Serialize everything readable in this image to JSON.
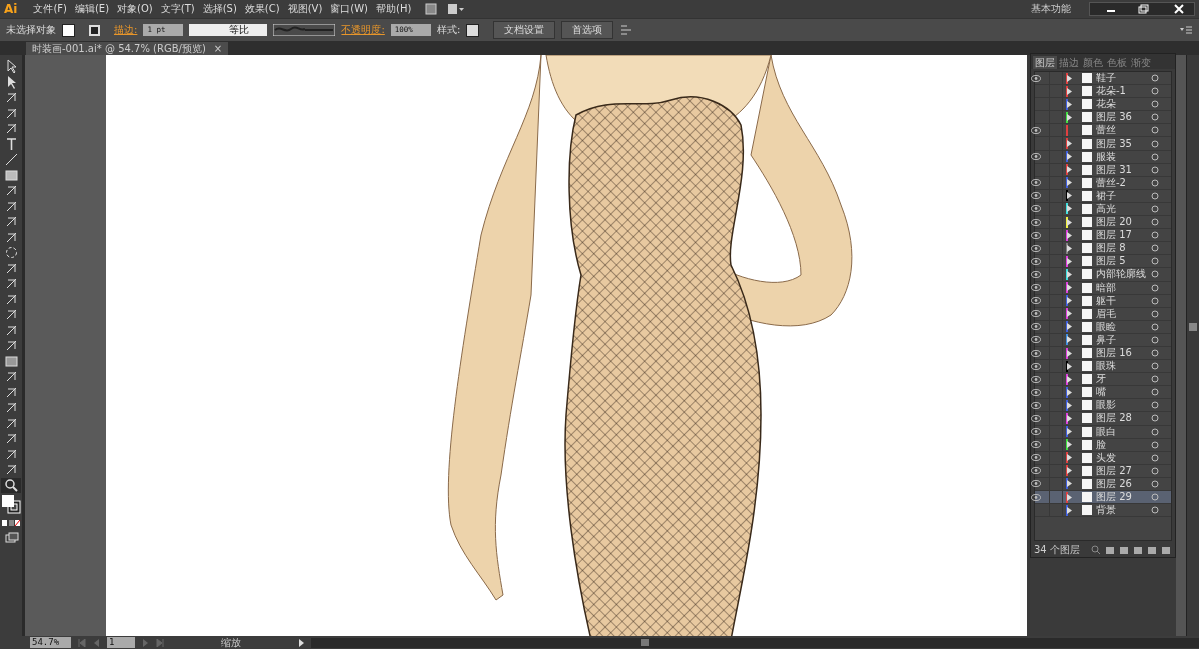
{
  "app": {
    "logo": "Ai",
    "workspace": "基本功能"
  },
  "menu": [
    "文件(F)",
    "编辑(E)",
    "对象(O)",
    "文字(T)",
    "选择(S)",
    "效果(C)",
    "视图(V)",
    "窗口(W)",
    "帮助(H)"
  ],
  "control_bar": {
    "selection": "未选择对象",
    "stroke_label": "描边:",
    "stroke_weight": "1 pt",
    "profile": "等比",
    "opacity_label": "不透明度:",
    "opacity": "100%",
    "style_label": "样式:",
    "buttons": [
      "文档设置",
      "首选项"
    ]
  },
  "document_tab": {
    "title": "时装画-001.ai* @ 54.7% (RGB/预览)",
    "close": "×"
  },
  "layers_panel": {
    "tabs": [
      {
        "label": "图层",
        "selected": true
      },
      {
        "label": "描边",
        "selected": false
      },
      {
        "label": "颜色",
        "selected": false
      },
      {
        "label": "色板",
        "selected": false
      },
      {
        "label": "渐变",
        "selected": false
      }
    ],
    "layers": [
      {
        "name": "鞋子",
        "visible": true,
        "color": "#e04040",
        "expandable": true,
        "selected": false
      },
      {
        "name": "花朵-1",
        "visible": false,
        "color": "#e04040",
        "expandable": true,
        "selected": false
      },
      {
        "name": "花朵",
        "visible": false,
        "color": "#4060e0",
        "expandable": true,
        "selected": false
      },
      {
        "name": "图层 36",
        "visible": false,
        "color": "#40e040",
        "expandable": true,
        "selected": false
      },
      {
        "name": "蕾丝",
        "visible": true,
        "color": "#e04040",
        "expandable": false,
        "selected": false
      },
      {
        "name": "图层 35",
        "visible": false,
        "color": "#e04040",
        "expandable": true,
        "selected": false
      },
      {
        "name": "服装",
        "visible": true,
        "color": "#4060e0",
        "expandable": true,
        "selected": false
      },
      {
        "name": "图层 31",
        "visible": false,
        "color": "#e04040",
        "expandable": true,
        "selected": false
      },
      {
        "name": "蕾丝-2",
        "visible": true,
        "color": "#4060e0",
        "expandable": true,
        "selected": false
      },
      {
        "name": "裙子",
        "visible": true,
        "color": "#000000",
        "expandable": true,
        "selected": false
      },
      {
        "name": "高光",
        "visible": true,
        "color": "#40e0e0",
        "expandable": true,
        "selected": false
      },
      {
        "name": "图层 20",
        "visible": true,
        "color": "#f0f040",
        "expandable": true,
        "selected": false
      },
      {
        "name": "图层 17",
        "visible": true,
        "color": "#e040e0",
        "expandable": true,
        "selected": false
      },
      {
        "name": "图层 8",
        "visible": true,
        "color": "#808080",
        "expandable": true,
        "selected": false
      },
      {
        "name": "图层 5",
        "visible": true,
        "color": "#e040e0",
        "expandable": true,
        "selected": false
      },
      {
        "name": "内部轮廓线",
        "visible": true,
        "color": "#40e0e0",
        "expandable": true,
        "selected": false
      },
      {
        "name": "暗部",
        "visible": true,
        "color": "#e040e0",
        "expandable": true,
        "selected": false
      },
      {
        "name": "躯干",
        "visible": true,
        "color": "#4060e0",
        "expandable": true,
        "selected": false
      },
      {
        "name": "眉毛",
        "visible": true,
        "color": "#e040e0",
        "expandable": true,
        "selected": false
      },
      {
        "name": "眼睑",
        "visible": true,
        "color": "#4060e0",
        "expandable": true,
        "selected": false
      },
      {
        "name": "鼻子",
        "visible": true,
        "color": "#4090e0",
        "expandable": true,
        "selected": false
      },
      {
        "name": "图层 16",
        "visible": true,
        "color": "#e040e0",
        "expandable": true,
        "selected": false
      },
      {
        "name": "眼珠",
        "visible": true,
        "color": "#000000",
        "expandable": true,
        "selected": false
      },
      {
        "name": "牙",
        "visible": true,
        "color": "#e040e0",
        "expandable": true,
        "selected": false
      },
      {
        "name": "嘴",
        "visible": true,
        "color": "#4060e0",
        "expandable": true,
        "selected": false
      },
      {
        "name": "眼影",
        "visible": true,
        "color": "#4060e0",
        "expandable": true,
        "selected": false
      },
      {
        "name": "图层 28",
        "visible": true,
        "color": "#e040e0",
        "expandable": true,
        "selected": false
      },
      {
        "name": "眼白",
        "visible": true,
        "color": "#4060e0",
        "expandable": true,
        "selected": false
      },
      {
        "name": "脸",
        "visible": true,
        "color": "#40e040",
        "expandable": true,
        "selected": false
      },
      {
        "name": "头发",
        "visible": true,
        "color": "#e04040",
        "expandable": true,
        "selected": false
      },
      {
        "name": "图层 27",
        "visible": true,
        "color": "#e04040",
        "expandable": true,
        "selected": false
      },
      {
        "name": "图层 26",
        "visible": true,
        "color": "#4060e0",
        "expandable": true,
        "selected": false
      },
      {
        "name": "图层 29",
        "visible": true,
        "color": "#e04040",
        "expandable": true,
        "selected": true
      },
      {
        "name": "背景",
        "visible": false,
        "color": "#4060e0",
        "expandable": true,
        "selected": false
      }
    ],
    "count": "34 个图层"
  },
  "status_bar": {
    "zoom": "54.7%",
    "artboard": "1",
    "tool": "缩放"
  }
}
